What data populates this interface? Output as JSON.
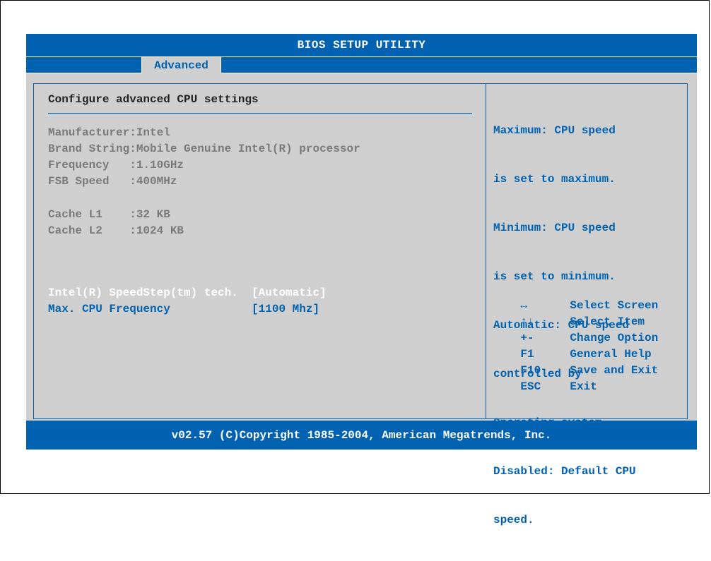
{
  "title": "BIOS SETUP UTILITY",
  "tabs": [
    {
      "label": "Advanced",
      "active": true
    }
  ],
  "heading": "Configure advanced CPU settings",
  "info": [
    {
      "label": "Manufacturer",
      "value": "Intel",
      "text": "Manufacturer:Intel"
    },
    {
      "label": "Brand String",
      "value": "Mobile Genuine Intel(R) processor",
      "text": "Brand String:Mobile Genuine Intel(R) processor"
    },
    {
      "label": "Frequency",
      "value": "1.10GHz",
      "text": "Frequency   :1.10GHz"
    },
    {
      "label": "FSB Speed",
      "value": "400MHz",
      "text": "FSB Speed   :400MHz"
    },
    {
      "label": "Cache L1",
      "value": "32 KB",
      "text": "Cache L1    :32 KB"
    },
    {
      "label": "Cache L2",
      "value": "1024 KB",
      "text": "Cache L2    :1024 KB"
    }
  ],
  "settings": [
    {
      "label": "Intel(R) SpeedStep(tm) tech.",
      "value": "[Automatic]",
      "text": "Intel(R) SpeedStep(tm) tech.  [Automatic]",
      "selected": true
    },
    {
      "label": "Max. CPU Frequency",
      "value": "[1100 Mhz]",
      "text": "Max. CPU Frequency            [1100 Mhz]",
      "selected": false
    }
  ],
  "help_lines": [
    "Maximum: CPU speed",
    "is set to maximum.",
    "Minimum: CPU speed",
    "is set to minimum.",
    "Automatic: CPU speed",
    "controlled by",
    "Operating system.",
    "Disabled: Default CPU",
    "speed."
  ],
  "keys": [
    {
      "key": "↔",
      "icon": "left-right-arrow-icon",
      "desc": "Select Screen"
    },
    {
      "key": "↑↓",
      "icon": "up-down-arrow-icon",
      "desc": "Select Item"
    },
    {
      "key": "+-",
      "icon": "",
      "desc": "Change Option"
    },
    {
      "key": "F1",
      "icon": "",
      "desc": "General Help"
    },
    {
      "key": "F10",
      "icon": "",
      "desc": "Save and Exit"
    },
    {
      "key": "ESC",
      "icon": "",
      "desc": "Exit"
    }
  ],
  "footer": "v02.57 (C)Copyright 1985-2004, American Megatrends, Inc.",
  "colors": {
    "bios_blue": "#0062b0",
    "panel_gray": "#cfcfcf",
    "dim_text": "#7a7a7a",
    "selected_text": "#ffffff"
  }
}
